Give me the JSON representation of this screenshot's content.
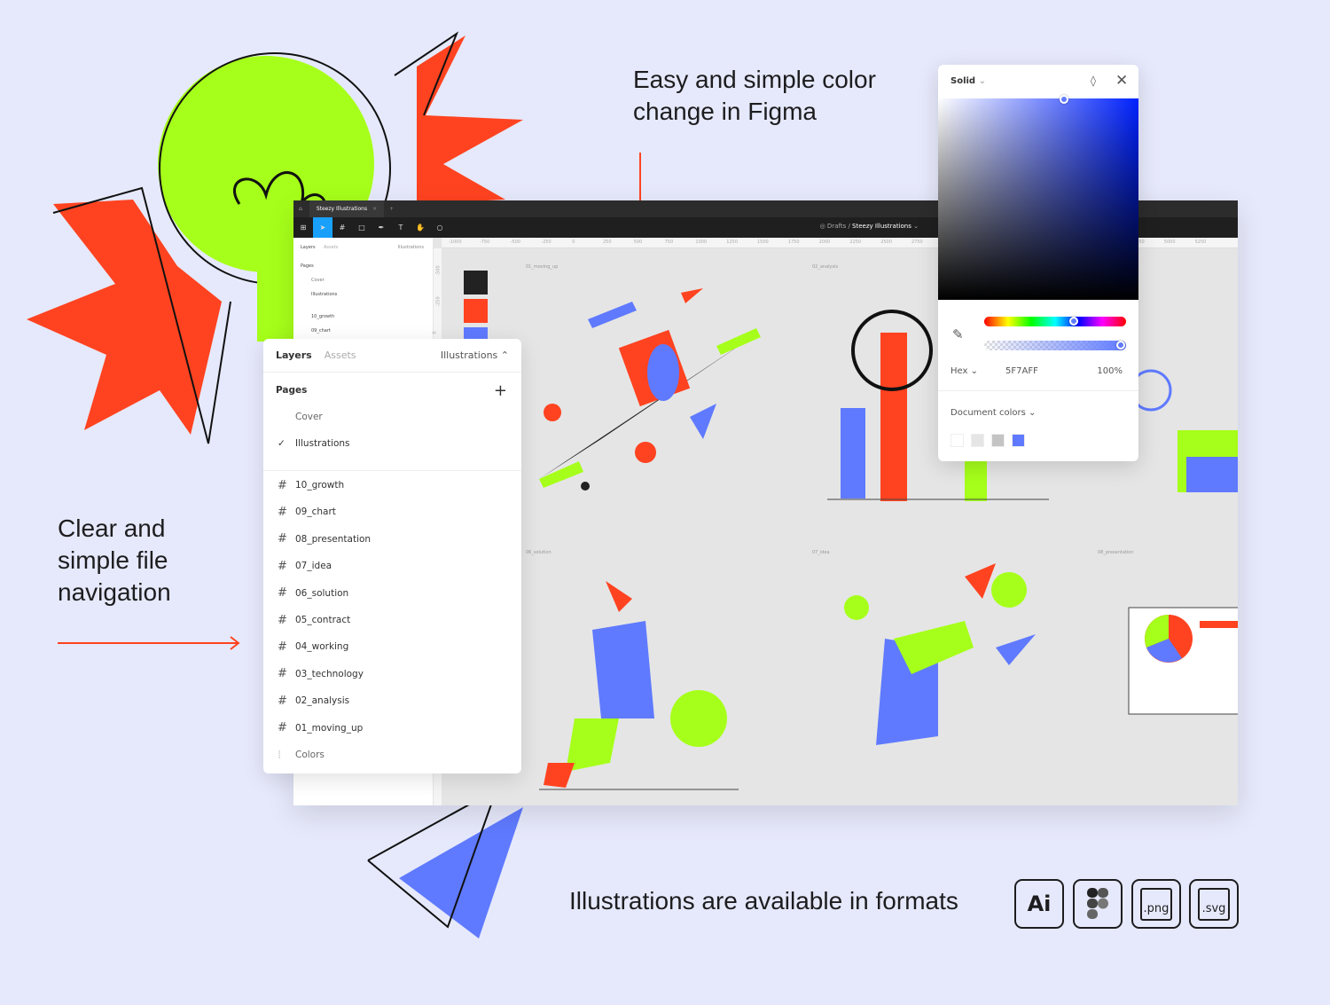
{
  "headlines": {
    "color_change": [
      "Easy and simple color",
      "change in Figma"
    ],
    "navigation": [
      "Clear and",
      "simple file",
      "navigation"
    ],
    "formats": "Illustrations are available in formats"
  },
  "figma": {
    "tab_title": "Steezy Illustrations",
    "breadcrumb": {
      "folder": "Drafts",
      "separator": "/",
      "file": "Steezy Illustrations"
    },
    "ruler_ticks": [
      "-1000",
      "-750",
      "-500",
      "-250",
      "0",
      "250",
      "500",
      "750",
      "1000",
      "1250",
      "1500",
      "1750",
      "2000",
      "2250",
      "2500",
      "2750"
    ],
    "ruler_ticks_right": [
      "4750",
      "5000",
      "5250"
    ],
    "vruler_ticks": [
      "-500",
      "-250",
      "0"
    ],
    "frames": [
      "01_moving_up",
      "02_analysis",
      "06_solution",
      "07_idea",
      "08_presentation"
    ],
    "small_panel": {
      "tabs": [
        "Layers",
        "Assets"
      ],
      "page_select": "Illustrations",
      "pages_label": "Pages",
      "pages": [
        "Cover",
        "Illustrations"
      ],
      "layers": [
        "10_growth",
        "09_chart"
      ]
    }
  },
  "layers_panel": {
    "tab_layers": "Layers",
    "tab_assets": "Assets",
    "page_select": "Illustrations",
    "pages_label": "Pages",
    "pages": [
      {
        "name": "Cover",
        "checked": false
      },
      {
        "name": "Illustrations",
        "checked": true
      }
    ],
    "layers": [
      "10_growth",
      "09_chart",
      "08_presentation",
      "07_idea",
      "06_solution",
      "05_contract",
      "04_working",
      "03_technology",
      "02_analysis",
      "01_moving_up"
    ],
    "colors_layer": "Colors"
  },
  "color_picker": {
    "mode": "Solid",
    "format": "Hex",
    "hex": "5F7AFF",
    "opacity": "100%",
    "hue_position": 0.63,
    "alpha_position": 1.0,
    "document_colors_label": "Document colors",
    "document_colors": [
      "#ffffff",
      "#e5e5e5",
      "#c4c4c4",
      "#5f7aff"
    ]
  },
  "palette": {
    "green": "#a6ff1a",
    "red": "#ff4320",
    "blue": "#5f7aff",
    "dark": "#222222",
    "accent": "#18a0fb"
  },
  "formats": [
    {
      "name": "Ai",
      "icon": "ai-icon"
    },
    {
      "name": "Figma",
      "icon": "figma-icon"
    },
    {
      "name": ".png",
      "icon": "png-file-icon"
    },
    {
      "name": ".svg",
      "icon": "svg-file-icon"
    }
  ]
}
